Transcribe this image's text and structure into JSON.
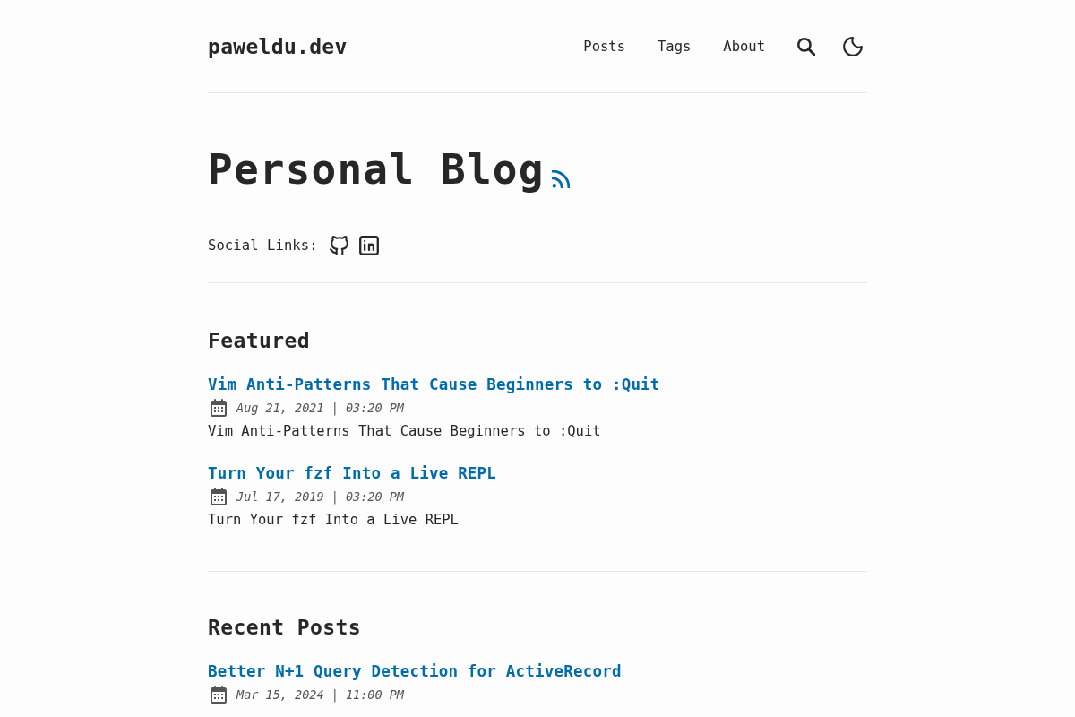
{
  "site": {
    "logo": "paweldu.dev",
    "nav": [
      {
        "label": "Posts"
      },
      {
        "label": "Tags"
      },
      {
        "label": "About"
      }
    ]
  },
  "hero": {
    "title": "Personal Blog",
    "social_label": "Social Links:"
  },
  "sections": [
    {
      "heading": "Featured",
      "posts": [
        {
          "title": "Vim Anti-Patterns That Cause Beginners to :Quit",
          "date": "Aug 21, 2021 | 03:20 PM",
          "description": "Vim Anti-Patterns That Cause Beginners to :Quit"
        },
        {
          "title": "Turn Your fzf Into a Live REPL",
          "date": "Jul 17, 2019 | 03:20 PM",
          "description": "Turn Your fzf Into a Live REPL"
        }
      ]
    },
    {
      "heading": "Recent Posts",
      "posts": [
        {
          "title": "Better N+1 Query Detection for ActiveRecord",
          "date": "Mar 15, 2024 | 11:00 PM"
        }
      ]
    }
  ]
}
